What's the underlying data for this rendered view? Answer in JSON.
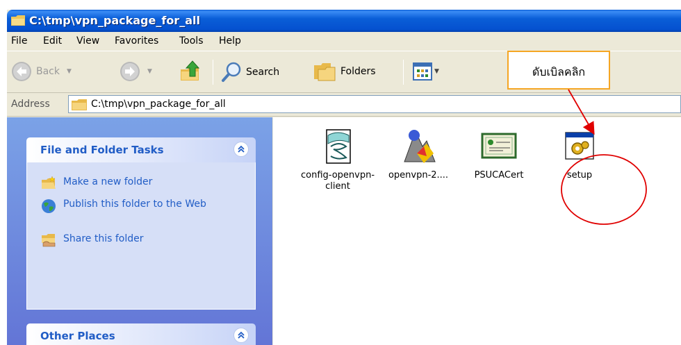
{
  "window": {
    "title": "C:\\tmp\\vpn_package_for_all"
  },
  "menu": [
    "File",
    "Edit",
    "View",
    "Favorites",
    "Tools",
    "Help"
  ],
  "toolbar": {
    "back": "Back",
    "search": "Search",
    "folders": "Folders"
  },
  "address": {
    "label": "Address",
    "value": "C:\\tmp\\vpn_package_for_all"
  },
  "tasks_panel": {
    "title": "File and Folder Tasks",
    "items": [
      {
        "label": "Make a new folder",
        "icon": "new-folder-icon"
      },
      {
        "label": "Publish this folder to the Web",
        "icon": "publish-web-icon"
      },
      {
        "label": "Share this folder",
        "icon": "share-folder-icon"
      }
    ]
  },
  "other_panel": {
    "title": "Other Places"
  },
  "files": [
    {
      "name": "config-openvpn-client",
      "icon": "config-file-icon"
    },
    {
      "name": "openvpn-2....",
      "icon": "installer-icon"
    },
    {
      "name": "PSUCACert",
      "icon": "certificate-icon"
    },
    {
      "name": "setup",
      "icon": "setup-app-icon"
    }
  ],
  "annotation": {
    "text": "ดับเบิลคลิก"
  },
  "colors": {
    "title_bar": "#0a5ed7",
    "task_link": "#215dc6",
    "callout_border": "#f5a623",
    "circle": "#e00000"
  }
}
